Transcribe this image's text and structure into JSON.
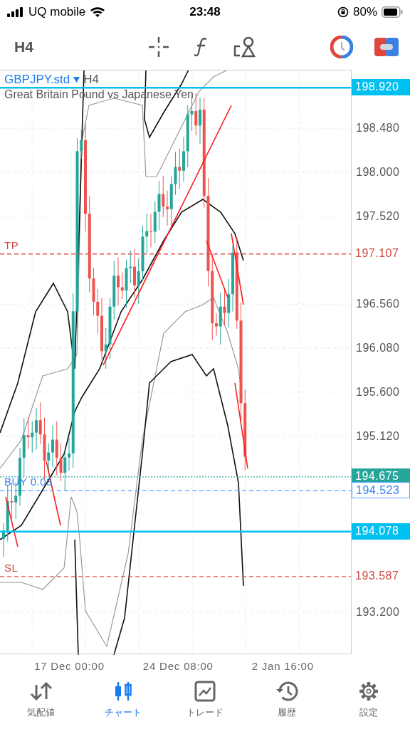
{
  "status_bar": {
    "carrier": "UQ mobile",
    "time": "23:48",
    "battery": "80%"
  },
  "toolbar": {
    "timeframe": "H4"
  },
  "chart": {
    "symbol": "GBPJPY.std",
    "symbol_timeframe": "H4",
    "description": "Great Britain Pound vs Japanese Yen",
    "price_ticks": [
      "198.480",
      "198.000",
      "197.520",
      "196.560",
      "196.080",
      "195.600",
      "195.120",
      "193.200"
    ],
    "time_labels": [
      "17 Dec 00:00",
      "24 Dec 08:00",
      "2 Jan 16:00"
    ],
    "levels": [
      {
        "kind": "highlight",
        "price": "198.920"
      },
      {
        "kind": "tp",
        "label": "TP",
        "price": "197.107"
      },
      {
        "kind": "bid",
        "price": "194.675"
      },
      {
        "kind": "position",
        "label": "BUY 0.03",
        "price": "194.523"
      },
      {
        "kind": "highlight",
        "price": "194.078"
      },
      {
        "kind": "sl",
        "label": "SL",
        "price": "193.587"
      }
    ]
  },
  "tabs": [
    {
      "kind": "quotes",
      "label": "気配値",
      "selected": false
    },
    {
      "kind": "chart",
      "label": "チャート",
      "selected": true
    },
    {
      "kind": "trade",
      "label": "トレード",
      "selected": false
    },
    {
      "kind": "history",
      "label": "履歴",
      "selected": false
    },
    {
      "kind": "settings",
      "label": "設定",
      "selected": false
    }
  ]
}
